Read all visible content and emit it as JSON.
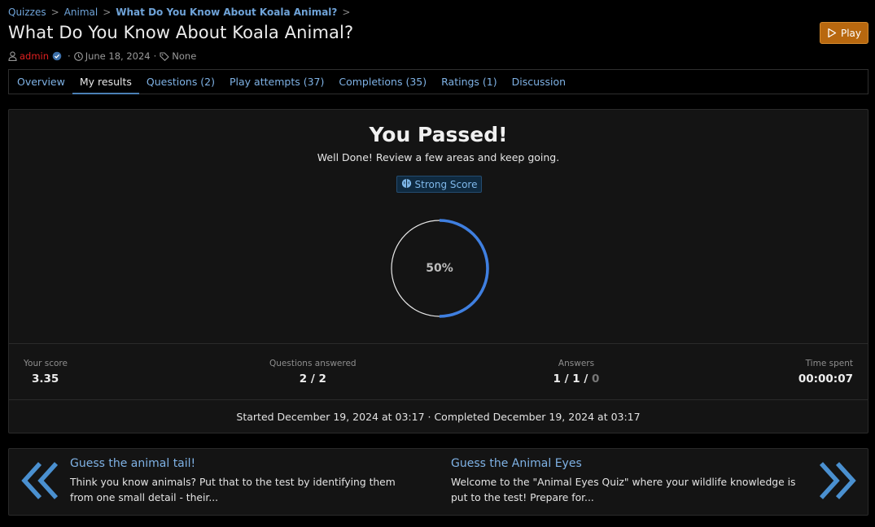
{
  "breadcrumb": {
    "items": [
      "Quizzes",
      "Animal",
      "What Do You Know About Koala Animal?"
    ]
  },
  "page": {
    "title": "What Do You Know About Koala Animal?",
    "play_label": "Play"
  },
  "meta": {
    "author": "admin",
    "date": "June 18, 2024",
    "tags": "None"
  },
  "tabs": [
    {
      "label": "Overview",
      "active": false
    },
    {
      "label": "My results",
      "active": true
    },
    {
      "label": "Questions (2)",
      "active": false
    },
    {
      "label": "Play attempts (37)",
      "active": false
    },
    {
      "label": "Completions (35)",
      "active": false
    },
    {
      "label": "Ratings (1)",
      "active": false
    },
    {
      "label": "Discussion",
      "active": false
    }
  ],
  "result": {
    "heading": "You Passed!",
    "subtitle": "Well Done! Review a few areas and keep going.",
    "badge_label": "Strong Score",
    "percent_label": "50%",
    "percent": 50
  },
  "stats": {
    "score_label": "Your score",
    "score_value": "3.35",
    "questions_label": "Questions answered",
    "questions_value": "2 / 2",
    "answers_label": "Answers",
    "answers_correct": "1",
    "answers_partial": "1",
    "answers_wrong": "0",
    "answers_sep": "/",
    "time_label": "Time spent",
    "time_value": "00:00:07"
  },
  "times": {
    "line": "Started December 19, 2024 at 03:17 · Completed December 19, 2024 at 03:17"
  },
  "navigation": {
    "prev": {
      "title": "Guess the animal tail!",
      "desc": "Think you know animals? Put that to the test by identifying them from one small detail - their..."
    },
    "next": {
      "title": "Guess the Animal Eyes",
      "desc": "Welcome to the \"Animal Eyes Quiz\" where your wildlife knowledge is put to the test! Prepare for..."
    }
  },
  "colors": {
    "accent": "#6fa3d8",
    "play_button": "#b8680f",
    "author": "#e02020",
    "gauge_progress": "#3f7fe0"
  },
  "icons": {
    "play": "play-icon",
    "user": "user-icon",
    "verified": "verified-badge-icon",
    "clock": "clock-icon",
    "tag": "tag-icon",
    "brain": "brain-icon",
    "prev": "double-chevron-left-icon",
    "next": "double-chevron-right-icon"
  }
}
